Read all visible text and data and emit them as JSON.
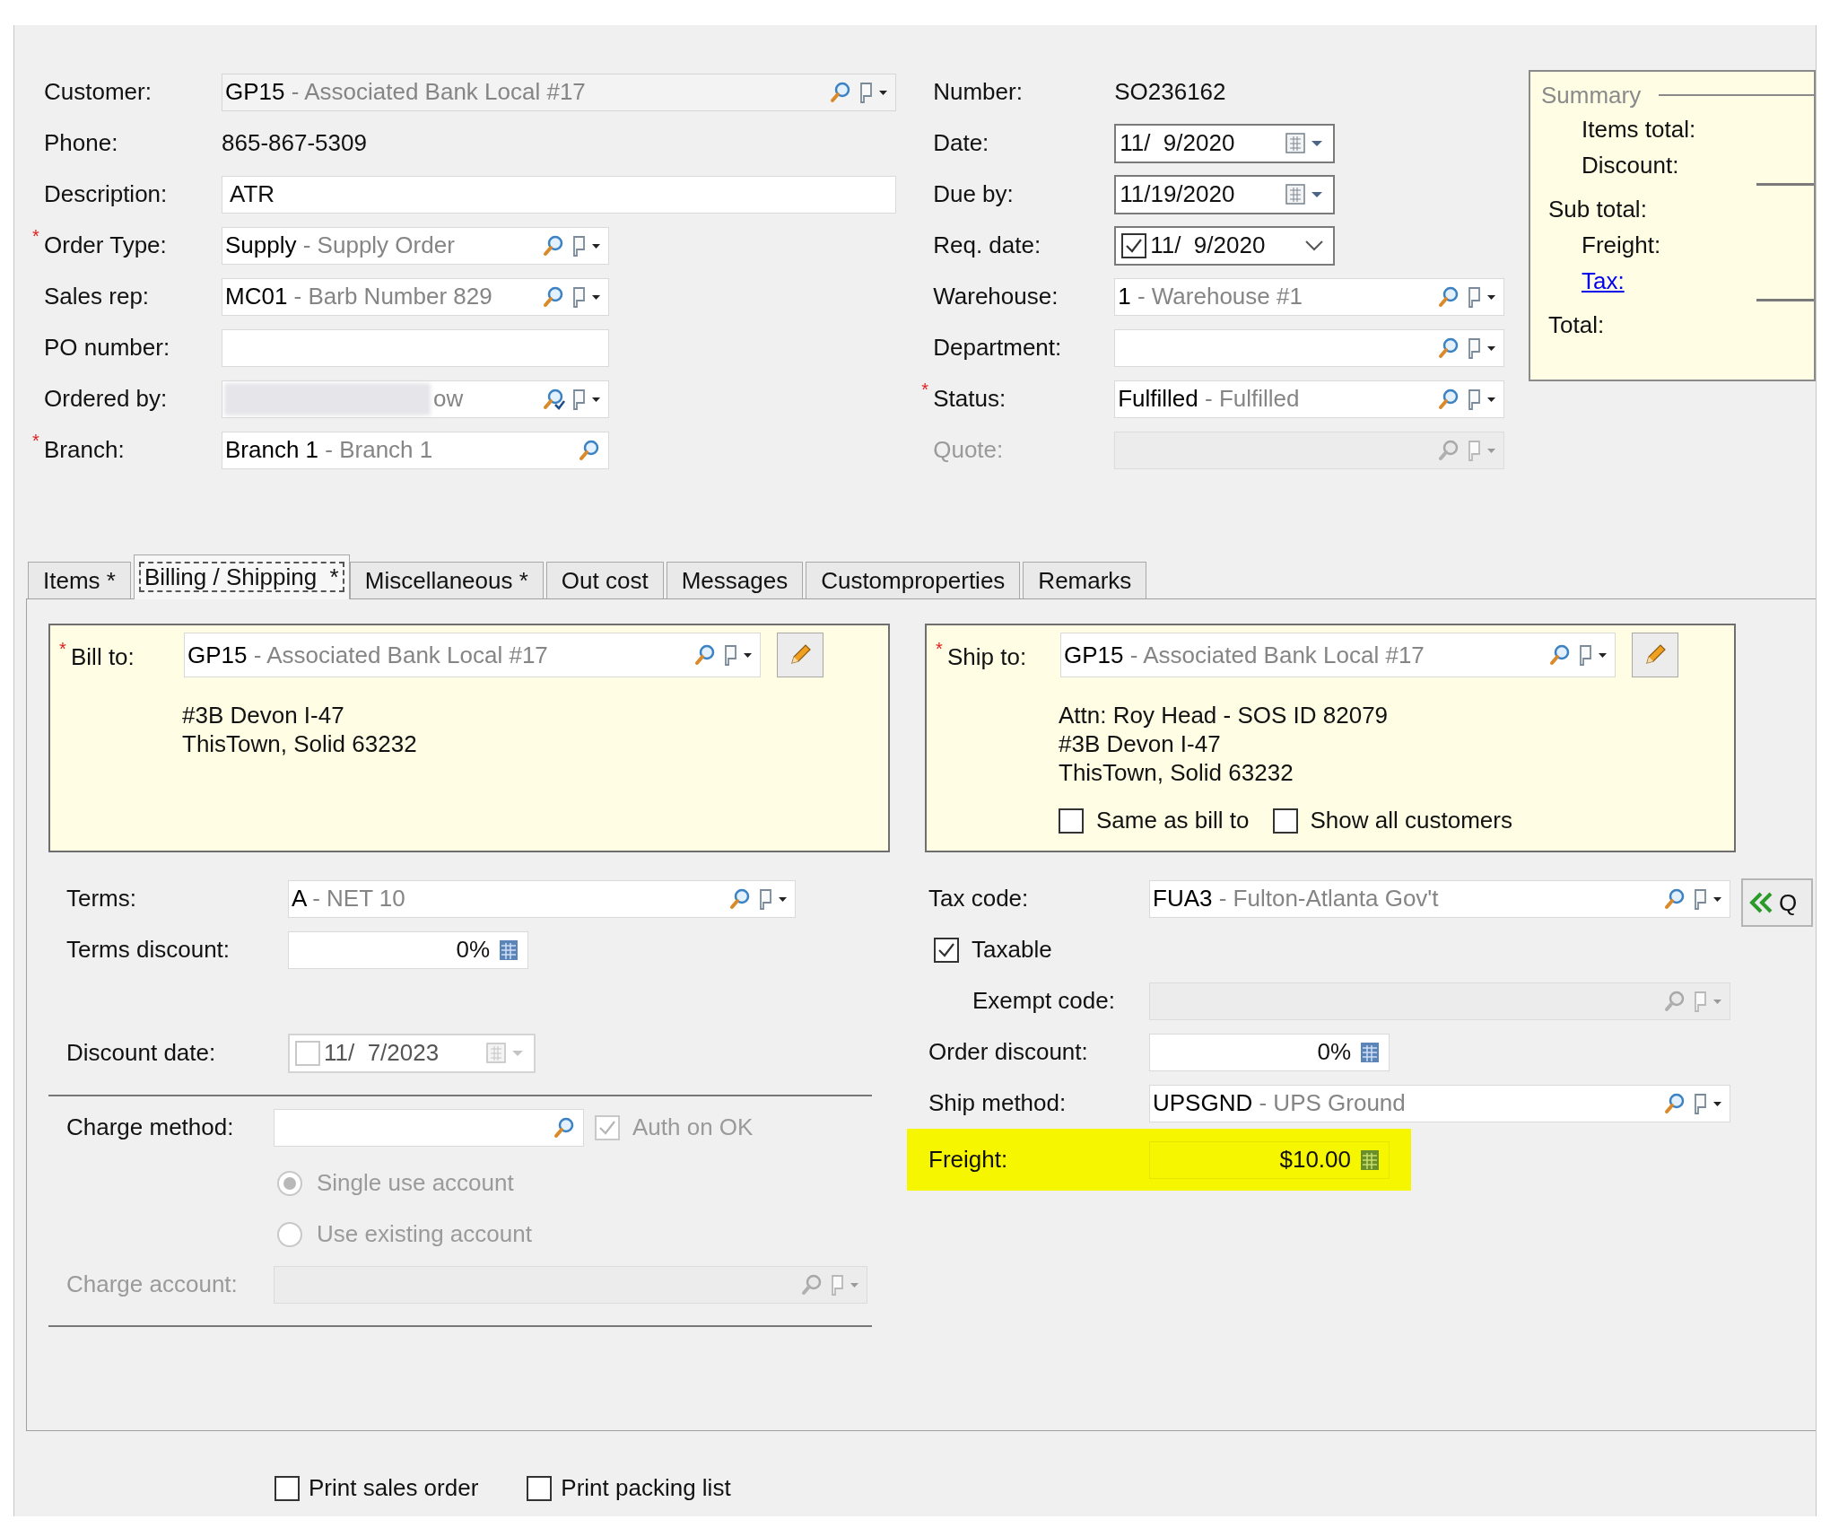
{
  "header": {
    "left": [
      {
        "label": "Customer:",
        "kind": "lookup",
        "code": "GP15",
        "description": "- Associated Bank Local #17",
        "menu": true,
        "readonly": true,
        "wide": true
      },
      {
        "label": "Phone:",
        "kind": "text",
        "value": "865-867-5309"
      },
      {
        "label": "Description:",
        "kind": "input",
        "value": "ATR",
        "wide": true
      },
      {
        "label": "Order Type:",
        "required": "*",
        "kind": "lookup",
        "code": "Supply",
        "description": "- Supply Order",
        "menu": true
      },
      {
        "label": "Sales rep:",
        "kind": "lookup",
        "code": "MC01",
        "description": "- Barb Number 829",
        "menu": true
      },
      {
        "label": "PO number:",
        "kind": "input"
      },
      {
        "label": "Ordered by:",
        "kind": "lookup",
        "redacted": true,
        "description": "ow",
        "menu": true,
        "verified": true
      },
      {
        "label": "Branch:",
        "required": "*",
        "kind": "lookup",
        "code": "Branch 1",
        "description": "- Branch 1",
        "menu": false
      }
    ],
    "right": [
      {
        "label": "Number:",
        "kind": "text",
        "value": "SO236162"
      },
      {
        "label": "Date:",
        "kind": "date",
        "value": "11/  9/2020"
      },
      {
        "label": "Due by:",
        "kind": "date",
        "value": "11/19/2020"
      },
      {
        "label": "Req. date:",
        "kind": "checkdate",
        "checked": true,
        "value": "11/  9/2020"
      },
      {
        "label": "Warehouse:",
        "kind": "lookup",
        "code": "1",
        "description": "- Warehouse #1",
        "menu": true
      },
      {
        "label": "Department:",
        "kind": "lookup",
        "menu": true
      },
      {
        "label": "Status:",
        "required": "*",
        "kind": "lookup",
        "code": "Fulfilled",
        "description": "- Fulfilled",
        "menu": true
      },
      {
        "label": "Quote:",
        "kind": "lookup",
        "menu": true,
        "disabled": true
      }
    ]
  },
  "summary": {
    "title": "Summary",
    "rows": [
      {
        "label": "Items total:",
        "indent": true
      },
      {
        "label": "Discount:",
        "indent": true,
        "rule_after": true
      },
      {
        "label": "Sub total:",
        "indent": false
      },
      {
        "label": "Freight:",
        "indent": true
      },
      {
        "label": "Tax:",
        "indent": true,
        "link": true,
        "rule_after": true
      },
      {
        "label": "Total:",
        "indent": false
      }
    ]
  },
  "tabs": [
    {
      "label": "Items *",
      "selected": false
    },
    {
      "label": "Billing / Shipping  *",
      "selected": true
    },
    {
      "label": "Miscellaneous *",
      "selected": false
    },
    {
      "label": "Out cost",
      "selected": false
    },
    {
      "label": "Messages",
      "selected": false
    },
    {
      "label": "Customproperties",
      "selected": false
    },
    {
      "label": "Remarks",
      "selected": false
    }
  ],
  "bill_to": {
    "label": "Bill to:",
    "required": "*",
    "field": {
      "code": "GP15",
      "description": "- Associated Bank Local #17",
      "menu": true
    },
    "address": [
      "#3B Devon I-47",
      "ThisTown, Solid 63232"
    ]
  },
  "ship_to": {
    "label": "Ship to:",
    "required": "*",
    "field": {
      "code": "GP15",
      "description": "- Associated Bank Local #17",
      "menu": true
    },
    "address": [
      "Attn: Roy Head - SOS ID 82079",
      "#3B Devon I-47",
      "ThisTown, Solid 63232"
    ],
    "options": [
      {
        "label": "Same as bill to",
        "checked": false
      },
      {
        "label": "Show all customers",
        "checked": false
      }
    ]
  },
  "terms": {
    "label": "Terms:",
    "code": "A",
    "description": "- NET 10",
    "menu": true
  },
  "terms_discount": {
    "label": "Terms discount:",
    "value": "0%"
  },
  "discount_date": {
    "label": "Discount date:",
    "checked": false,
    "value": "11/  7/2023",
    "disabled": true
  },
  "charge_method": {
    "label": "Charge method:",
    "menu": false,
    "auth": {
      "label": "Auth on OK",
      "checked": true,
      "disabled": true
    }
  },
  "payment_options": [
    {
      "label": "Single use account",
      "selected": true,
      "disabled": true
    },
    {
      "label": "Use existing account",
      "selected": false,
      "disabled": true
    }
  ],
  "charge_account": {
    "label": "Charge account:",
    "menu": true,
    "disabled": true
  },
  "tax_code": {
    "label": "Tax code:",
    "code": "FUA3",
    "description": "- Fulton-Atlanta Gov't",
    "menu": true
  },
  "taxable": {
    "label": "Taxable",
    "checked": true
  },
  "exempt_code": {
    "label": "Exempt code:",
    "menu": true,
    "disabled": true
  },
  "order_discount": {
    "label": "Order discount:",
    "value": "0%"
  },
  "ship_method": {
    "label": "Ship method:",
    "code": "UPSGND",
    "description": "- UPS Ground",
    "menu": true
  },
  "freight": {
    "label": "Freight:",
    "value": "$10.00",
    "highlighted": true
  },
  "side_button": {
    "label": "Q"
  },
  "print_options": [
    {
      "label": "Print sales order",
      "checked": false
    },
    {
      "label": "Print packing list",
      "checked": false
    }
  ]
}
